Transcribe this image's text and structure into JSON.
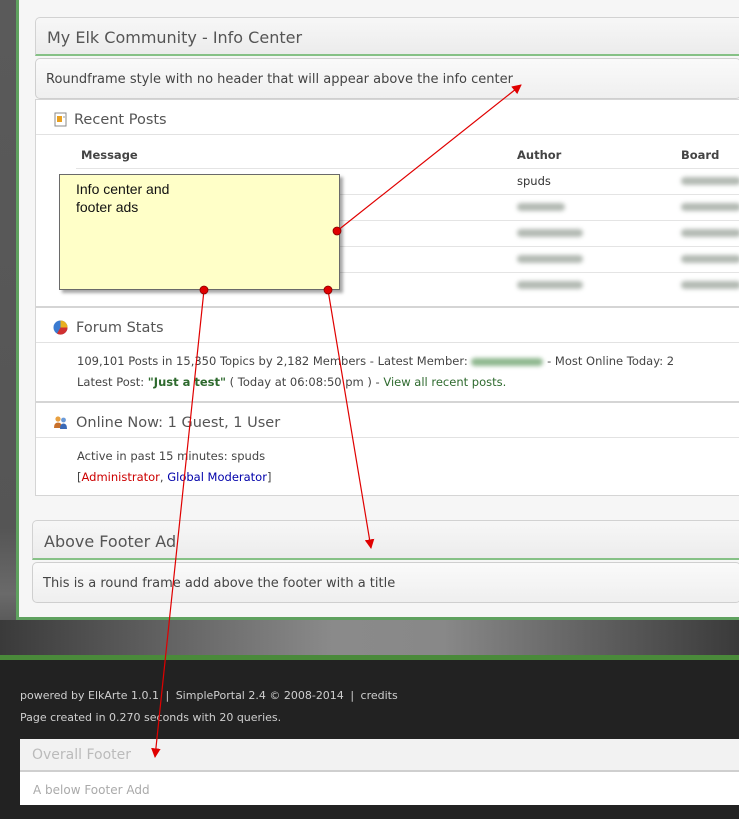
{
  "info_center": {
    "title": "My Elk Community - Info Center",
    "roundframe_text": "Roundframe style with no header that will appear above the info center"
  },
  "recent_posts": {
    "title": "Recent Posts",
    "icon": "document-icon",
    "columns": [
      "Message",
      "Author",
      "Board"
    ],
    "rows": [
      {
        "author": "spuds"
      },
      {
        "author": ""
      },
      {
        "author": ""
      },
      {
        "author": ""
      },
      {
        "author": ""
      }
    ]
  },
  "annotation": {
    "line1": "Info center and",
    "line2": "footer ads"
  },
  "forum_stats": {
    "title": "Forum Stats",
    "icon": "pie-chart-icon",
    "line1_prefix": "109,101 Posts in 15,350 Topics by 2,182 Members - Latest Member:",
    "line1_suffix": "- Most Online Today: 2",
    "latest_post_label": "Latest Post:",
    "latest_post_title": "\"Just a test\"",
    "latest_post_time": "( Today at 06:08:50 pm )",
    "separator": "-",
    "view_all": "View all recent posts."
  },
  "online_now": {
    "title": "Online Now: 1 Guest, 1 User",
    "icon": "users-icon",
    "active_text": "Active in past 15 minutes: spuds",
    "open_bracket": "[",
    "admin": "Administrator",
    "comma": ",",
    "moderator": "Global Moderator",
    "close_bracket": "]"
  },
  "above_footer": {
    "title": "Above Footer Ad",
    "body": "This is a round frame add above the footer with a title"
  },
  "footer": {
    "powered": "powered by ElkArte 1.0.1",
    "portal": "SimplePortal 2.4 © 2008-2014",
    "credits": "credits",
    "sep": "|",
    "page_created": "Page created in 0.270 seconds with 20 queries.",
    "overall_title": "Overall Footer",
    "overall_body": "A below Footer Add"
  },
  "colors": {
    "accent_green": "#5fa15f",
    "admin_red": "#cc0000",
    "mod_blue": "#0000aa",
    "arrow_red": "#e00000"
  }
}
